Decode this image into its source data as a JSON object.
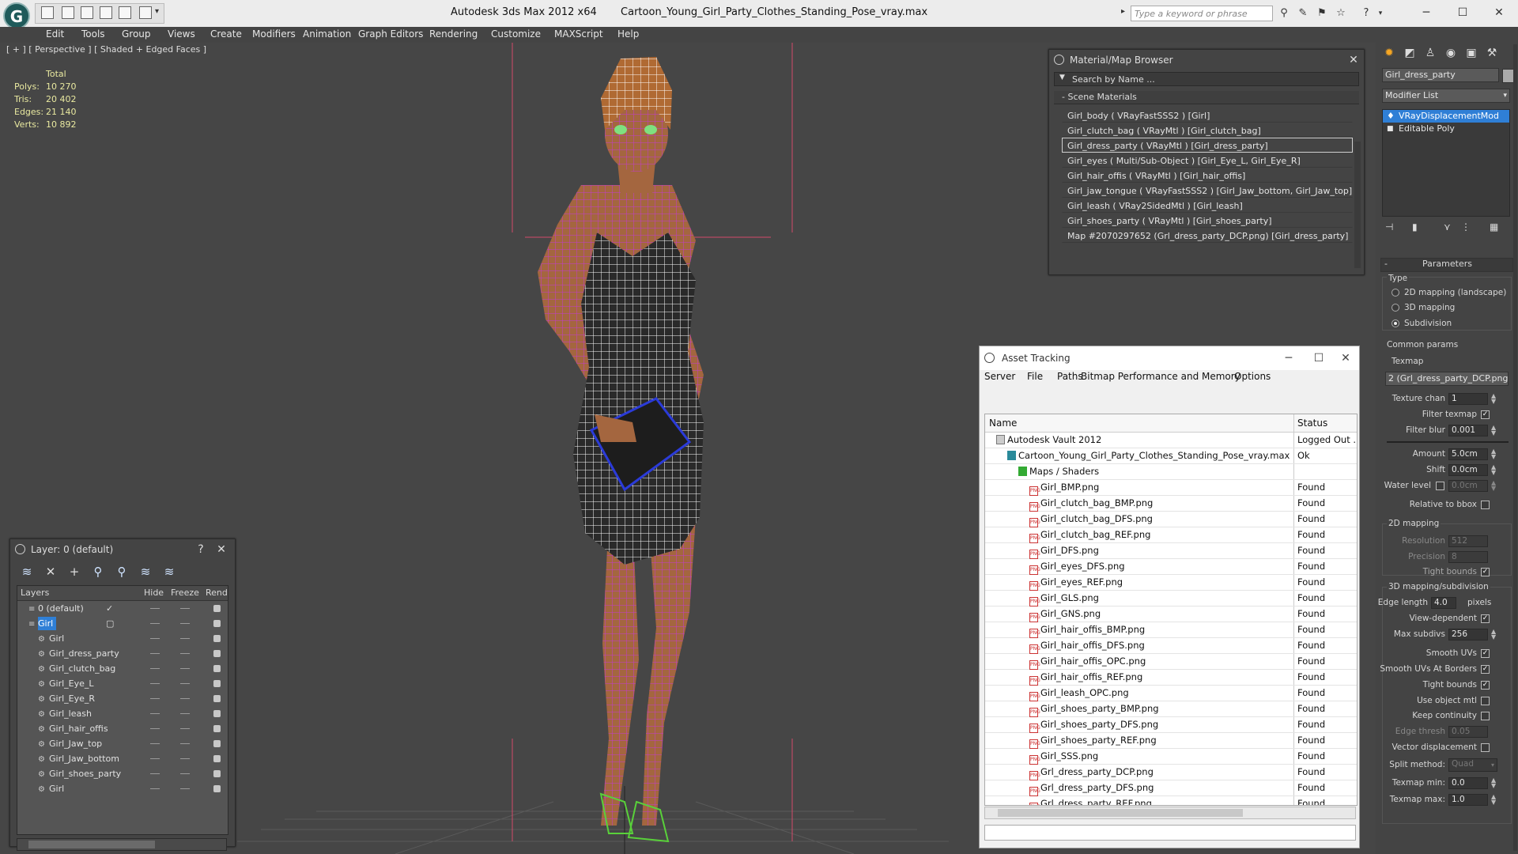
{
  "title": {
    "app": "Autodesk 3ds Max  2012 x64",
    "file": "Cartoon_Young_Girl_Party_Clothes_Standing_Pose_vray.max"
  },
  "search": {
    "placeholder": "Type a keyword or phrase"
  },
  "menu": [
    "Edit",
    "Tools",
    "Group",
    "Views",
    "Create",
    "Modifiers",
    "Animation",
    "Graph Editors",
    "Rendering",
    "Customize",
    "MAXScript",
    "Help"
  ],
  "viewport": {
    "label": "[ + ] [ Perspective ] [ Shaded + Edged Faces ]",
    "stats": {
      "header": "Total",
      "rows": [
        {
          "label": "Polys:",
          "value": "10 270"
        },
        {
          "label": "Tris:",
          "value": "20 402"
        },
        {
          "label": "Edges:",
          "value": "21 140"
        },
        {
          "label": "Verts:",
          "value": "10 892"
        }
      ]
    }
  },
  "material_browser": {
    "title": "Material/Map Browser",
    "search_placeholder": "Search by Name ...",
    "group": "- Scene Materials",
    "items": [
      "Girl_body  ( VRayFastSSS2 ) [Girl]",
      "Girl_clutch_bag  ( VRayMtl ) [Girl_clutch_bag]",
      "Girl_dress_party  ( VRayMtl ) [Girl_dress_party]",
      "Girl_eyes  ( Multi/Sub-Object ) [Girl_Eye_L, Girl_Eye_R]",
      "Girl_hair_offis  ( VRayMtl ) [Girl_hair_offis]",
      "Girl_jaw_tongue  ( VRayFastSSS2 ) [Girl_Jaw_bottom, Girl_Jaw_top]",
      "Girl_leash  ( VRay2SidedMtl ) [Girl_leash]",
      "Girl_shoes_party  ( VRayMtl ) [Girl_shoes_party]",
      "Map #2070297652 (Grl_dress_party_DCP.png) [Girl_dress_party]"
    ],
    "selected_index": 2
  },
  "asset_tracking": {
    "title": "Asset Tracking",
    "menu": [
      "Server",
      "File",
      "Paths",
      "Bitmap Performance and Memory",
      "Options"
    ],
    "columns": {
      "name": "Name",
      "status": "Status"
    },
    "rows": [
      {
        "name": "Autodesk Vault 2012",
        "status": "Logged Out ...",
        "indent": 0,
        "kind": "vault"
      },
      {
        "name": "Cartoon_Young_Girl_Party_Clothes_Standing_Pose_vray.max",
        "status": "Ok",
        "indent": 1,
        "kind": "max"
      },
      {
        "name": "Maps / Shaders",
        "status": "",
        "indent": 2,
        "kind": "folder"
      },
      {
        "name": "Girl_BMP.png",
        "status": "Found",
        "indent": 3,
        "kind": "png"
      },
      {
        "name": "Girl_clutch_bag_BMP.png",
        "status": "Found",
        "indent": 3,
        "kind": "png"
      },
      {
        "name": "Girl_clutch_bag_DFS.png",
        "status": "Found",
        "indent": 3,
        "kind": "png"
      },
      {
        "name": "Girl_clutch_bag_REF.png",
        "status": "Found",
        "indent": 3,
        "kind": "png"
      },
      {
        "name": "Girl_DFS.png",
        "status": "Found",
        "indent": 3,
        "kind": "png"
      },
      {
        "name": "Girl_eyes_DFS.png",
        "status": "Found",
        "indent": 3,
        "kind": "png"
      },
      {
        "name": "Girl_eyes_REF.png",
        "status": "Found",
        "indent": 3,
        "kind": "png"
      },
      {
        "name": "Girl_GLS.png",
        "status": "Found",
        "indent": 3,
        "kind": "png"
      },
      {
        "name": "Girl_GNS.png",
        "status": "Found",
        "indent": 3,
        "kind": "png"
      },
      {
        "name": "Girl_hair_offis_BMP.png",
        "status": "Found",
        "indent": 3,
        "kind": "png"
      },
      {
        "name": "Girl_hair_offis_DFS.png",
        "status": "Found",
        "indent": 3,
        "kind": "png"
      },
      {
        "name": "Girl_hair_offis_OPC.png",
        "status": "Found",
        "indent": 3,
        "kind": "png"
      },
      {
        "name": "Girl_hair_offis_REF.png",
        "status": "Found",
        "indent": 3,
        "kind": "png"
      },
      {
        "name": "Girl_leash_OPC.png",
        "status": "Found",
        "indent": 3,
        "kind": "png"
      },
      {
        "name": "Girl_shoes_party_BMP.png",
        "status": "Found",
        "indent": 3,
        "kind": "png"
      },
      {
        "name": "Girl_shoes_party_DFS.png",
        "status": "Found",
        "indent": 3,
        "kind": "png"
      },
      {
        "name": "Girl_shoes_party_REF.png",
        "status": "Found",
        "indent": 3,
        "kind": "png"
      },
      {
        "name": "Girl_SSS.png",
        "status": "Found",
        "indent": 3,
        "kind": "png"
      },
      {
        "name": "Grl_dress_party_DCP.png",
        "status": "Found",
        "indent": 3,
        "kind": "png"
      },
      {
        "name": "Grl_dress_party_DFS.png",
        "status": "Found",
        "indent": 3,
        "kind": "png"
      },
      {
        "name": "Grl_dress_party_REF.png",
        "status": "Found",
        "indent": 3,
        "kind": "png"
      }
    ]
  },
  "layer_manager": {
    "title": "Layer: 0 (default)",
    "columns": {
      "layers": "Layers",
      "hide": "Hide",
      "freeze": "Freeze",
      "render": "Rend"
    },
    "rows": [
      {
        "name": "0 (default)",
        "indent": 1,
        "kind": "layer",
        "current": true
      },
      {
        "name": "Girl",
        "indent": 1,
        "kind": "layer",
        "selected": true
      },
      {
        "name": "Girl",
        "indent": 2,
        "kind": "object"
      },
      {
        "name": "Girl_dress_party",
        "indent": 2,
        "kind": "object"
      },
      {
        "name": "Girl_clutch_bag",
        "indent": 2,
        "kind": "object"
      },
      {
        "name": "Girl_Eye_L",
        "indent": 2,
        "kind": "object"
      },
      {
        "name": "Girl_Eye_R",
        "indent": 2,
        "kind": "object"
      },
      {
        "name": "Girl_leash",
        "indent": 2,
        "kind": "object"
      },
      {
        "name": "Girl_hair_offis",
        "indent": 2,
        "kind": "object"
      },
      {
        "name": "Girl_Jaw_top",
        "indent": 2,
        "kind": "object"
      },
      {
        "name": "Girl_Jaw_bottom",
        "indent": 2,
        "kind": "object"
      },
      {
        "name": "Girl_shoes_party",
        "indent": 2,
        "kind": "object"
      },
      {
        "name": "Girl",
        "indent": 2,
        "kind": "object"
      }
    ]
  },
  "command_panel": {
    "object_name": "Girl_dress_party",
    "modifier_list": "Modifier List",
    "stack": [
      "VRayDisplacementMod",
      "Editable Poly"
    ],
    "params_title": "Parameters",
    "type_label": "Type",
    "type_options": [
      "2D mapping (landscape)",
      "3D mapping",
      "Subdivision"
    ],
    "type_selected": 2,
    "common_label": "Common params",
    "texmap_label": "Texmap",
    "texmap_value": "2 (Grl_dress_party_DCP.png)",
    "texture_chan": {
      "label": "Texture chan",
      "value": "1"
    },
    "filter_texmap": {
      "label": "Filter texmap",
      "checked": true
    },
    "filter_blur": {
      "label": "Filter blur",
      "value": "0.001"
    },
    "amount": {
      "label": "Amount",
      "value": "5.0cm"
    },
    "shift": {
      "label": "Shift",
      "value": "0.0cm"
    },
    "water_level": {
      "label": "Water level",
      "value": "0.0cm"
    },
    "relative_bbox": {
      "label": "Relative to bbox"
    },
    "map2d_label": "2D mapping",
    "resolution": {
      "label": "Resolution",
      "value": "512"
    },
    "precision": {
      "label": "Precision",
      "value": "8"
    },
    "tight_bounds_2d": {
      "label": "Tight bounds"
    },
    "map3d_label": "3D mapping/subdivision",
    "edge_length": {
      "label": "Edge length",
      "value": "4.0",
      "unit": "pixels"
    },
    "view_dependent": {
      "label": "View-dependent"
    },
    "max_subdivs": {
      "label": "Max subdivs",
      "value": "256"
    },
    "smooth_uvs": {
      "label": "Smooth UVs"
    },
    "smooth_uvs_borders": {
      "label": "Smooth UVs At Borders"
    },
    "tight_bounds": {
      "label": "Tight bounds"
    },
    "use_object_mtl": {
      "label": "Use object mtl"
    },
    "keep_continuity": {
      "label": "Keep continuity"
    },
    "edge_thresh": {
      "label": "Edge thresh",
      "value": "0.05"
    },
    "vector_disp": {
      "label": "Vector displacement"
    },
    "split_method": {
      "label": "Split method:",
      "value": "Quad"
    },
    "texmap_min": {
      "label": "Texmap min:",
      "value": "0.0"
    },
    "texmap_max": {
      "label": "Texmap max:",
      "value": "1.0"
    }
  },
  "colors": {
    "accent": "#2f7fd6",
    "wire": "#c23ad0",
    "skin": "#a4663f",
    "viewport": "#464646"
  }
}
